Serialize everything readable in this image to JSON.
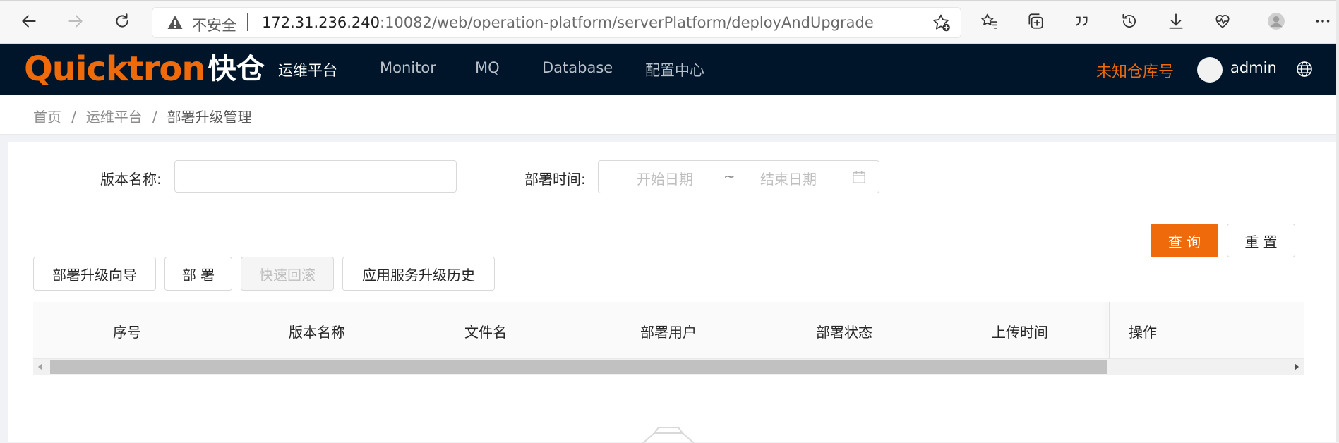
{
  "browser": {
    "security_label": "不安全",
    "url_host": "172.31.236.240",
    "url_rest": ":10082/web/operation-platform/serverPlatform/deployAndUpgrade",
    "icons": [
      "back-icon",
      "forward-icon",
      "refresh-icon",
      "warning-icon",
      "add-favorite-icon",
      "favorites-icon",
      "collections-icon",
      "quote-icon",
      "history-icon",
      "download-icon",
      "health-icon",
      "profile-icon",
      "more-icon"
    ]
  },
  "header": {
    "logo_en": "Quicktron",
    "logo_cn": "快仓",
    "nav": [
      "运维平台",
      "Monitor",
      "MQ",
      "Database",
      "配置中心"
    ],
    "active_nav": "运维平台",
    "warehouse": "未知仓库号",
    "username": "admin",
    "accent_color": "#ee6a0b",
    "bg_color": "#001529"
  },
  "breadcrumb": {
    "items": [
      "首页",
      "运维平台",
      "部署升级管理"
    ],
    "separator": "/"
  },
  "filters": {
    "version_label": "版本名称:",
    "version_value": "",
    "time_label": "部署时间:",
    "start_placeholder": "开始日期",
    "range_sep": "~",
    "end_placeholder": "结束日期"
  },
  "actions": {
    "query": "查 询",
    "reset": "重 置",
    "wizard": "部署升级向导",
    "deploy": "部 署",
    "rollback": "快速回滚",
    "history": "应用服务升级历史"
  },
  "table": {
    "columns": [
      "序号",
      "版本名称",
      "文件名",
      "部署用户",
      "部署状态",
      "上传时间",
      "操作"
    ],
    "rows": []
  }
}
